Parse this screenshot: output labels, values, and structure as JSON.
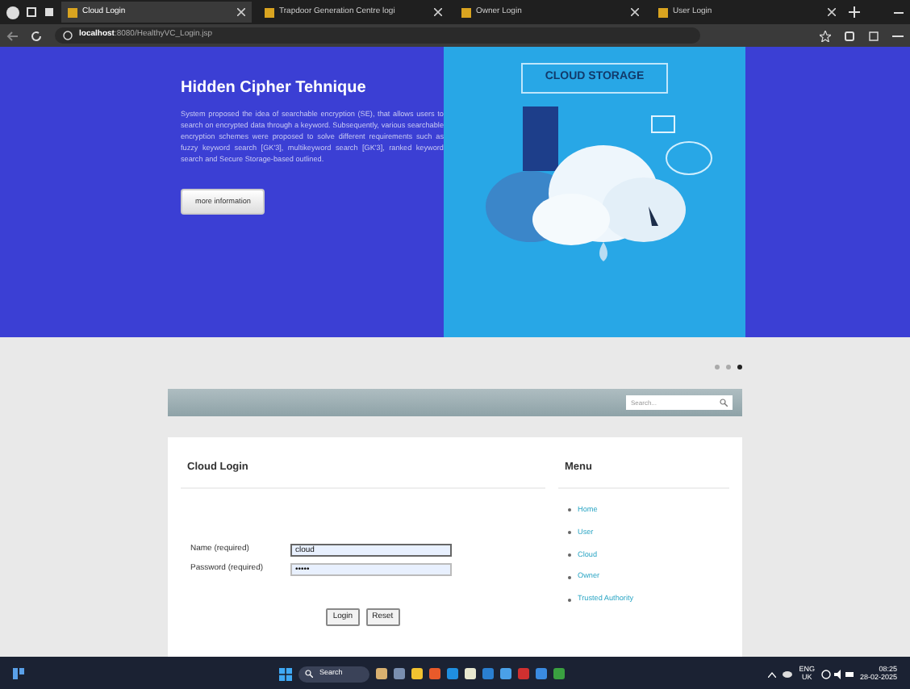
{
  "browser": {
    "tabs": [
      {
        "title": "Cloud Login",
        "selected": true
      },
      {
        "title": "Trapdoor Generation Centre logi",
        "selected": false
      },
      {
        "title": "Owner Login",
        "selected": false
      },
      {
        "title": "User Login",
        "selected": false
      }
    ],
    "url_host": "localhost",
    "url_path": ":8080/HealthyVC_Login.jsp"
  },
  "hero": {
    "title": "Hidden Cipher Tehnique",
    "paragraph": "System proposed the idea of searchable encryption (SE), that allows users to search on encrypted data through a keyword. Subsequently, various searchable encryption schemes were proposed to solve different requirements such as fuzzy keyword search [GK'3], multikeyword search [GK'3], ranked keyword search and Secure Storage-based outlined.",
    "button": "more information",
    "image_caption": "CLOUD STORAGE"
  },
  "carousel": {
    "dots": [
      {
        "selected": false
      },
      {
        "selected": false
      },
      {
        "selected": true
      }
    ]
  },
  "search": {
    "placeholder": "Search..."
  },
  "login": {
    "title": "Cloud Login",
    "fields": [
      {
        "label": "Name (required)",
        "value": "cloud",
        "focused": true
      },
      {
        "label": "Password (required)",
        "value": "•••••",
        "focused": false
      }
    ],
    "buttons": [
      "Login",
      "Reset"
    ]
  },
  "menu": {
    "title": "Menu",
    "items": [
      "Home",
      "User",
      "Cloud",
      "Owner",
      "Trusted Authority"
    ]
  },
  "taskbar": {
    "search": "Search",
    "lang": "ENG",
    "region": "UK",
    "time": "08:25",
    "date": "28-02-2025"
  }
}
